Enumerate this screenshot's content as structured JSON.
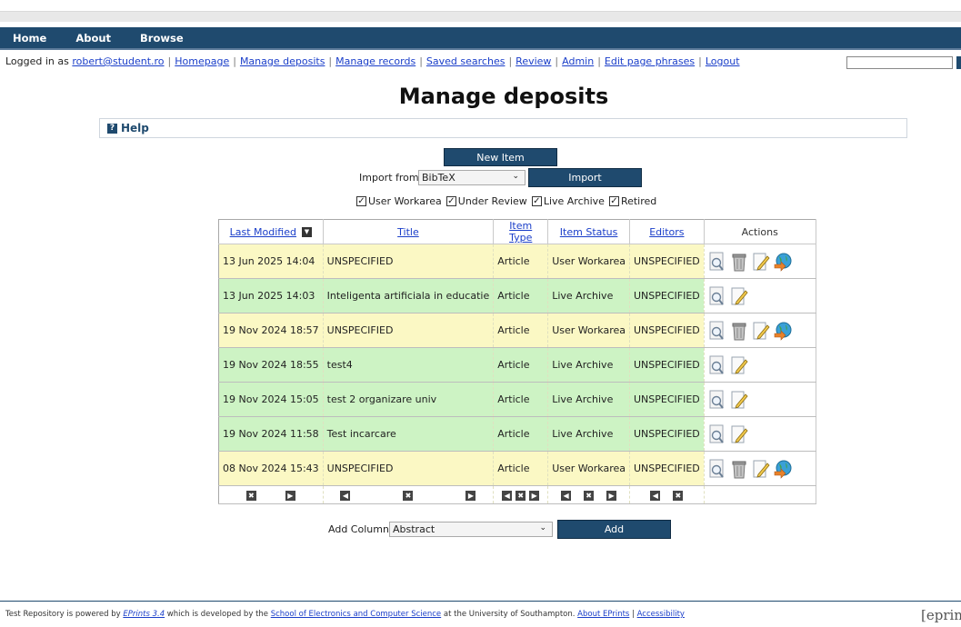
{
  "nav": {
    "home": "Home",
    "about": "About",
    "browse": "Browse"
  },
  "userbar": {
    "prefix": "Logged in as",
    "user": "robert@student.ro",
    "links": [
      "Homepage",
      "Manage deposits",
      "Manage records",
      "Saved searches",
      "Review",
      "Admin",
      "Edit page phrases",
      "Logout"
    ]
  },
  "page_title": "Manage deposits",
  "help": {
    "label": "Help",
    "icon": "?"
  },
  "controls": {
    "new_item": "New Item",
    "import_label": "Import from",
    "import_value": "BibTeX",
    "import_button": "Import",
    "filters": [
      "User Workarea",
      "Under Review",
      "Live Archive",
      "Retired"
    ],
    "add_column_label": "Add Column",
    "add_column_value": "Abstract",
    "add_button": "Add"
  },
  "table": {
    "headers": [
      "Last Modified",
      "Title",
      "Item Type",
      "Item Status",
      "Editors",
      "Actions"
    ],
    "rows": [
      {
        "modified": "13 Jun 2025 14:04",
        "title": "UNSPECIFIED",
        "type": "Article",
        "status": "User Workarea",
        "editors": "UNSPECIFIED",
        "kind": "inbox"
      },
      {
        "modified": "13 Jun 2025 14:03",
        "title": "Inteligenta artificiala in educatie",
        "type": "Article",
        "status": "Live Archive",
        "editors": "UNSPECIFIED",
        "kind": "archive"
      },
      {
        "modified": "19 Nov 2024 18:57",
        "title": "UNSPECIFIED",
        "type": "Article",
        "status": "User Workarea",
        "editors": "UNSPECIFIED",
        "kind": "inbox"
      },
      {
        "modified": "19 Nov 2024 18:55",
        "title": "test4",
        "type": "Article",
        "status": "Live Archive",
        "editors": "UNSPECIFIED",
        "kind": "archive"
      },
      {
        "modified": "19 Nov 2024 15:05",
        "title": "test 2 organizare univ",
        "type": "Article",
        "status": "Live Archive",
        "editors": "UNSPECIFIED",
        "kind": "archive"
      },
      {
        "modified": "19 Nov 2024 11:58",
        "title": "Test incarcare",
        "type": "Article",
        "status": "Live Archive",
        "editors": "UNSPECIFIED",
        "kind": "archive"
      },
      {
        "modified": "08 Nov 2024 15:43",
        "title": "UNSPECIFIED",
        "type": "Article",
        "status": "User Workarea",
        "editors": "UNSPECIFIED",
        "kind": "inbox"
      }
    ]
  },
  "footer": {
    "t1": "Test Repository is powered by ",
    "l1": "EPrints 3.4",
    "t2": " which is developed by the ",
    "l2": "School of Electronics and Computer Science",
    "t3": " at the University of Southampton. ",
    "l3": "About EPrints",
    "sep": " | ",
    "l4": "Accessibility"
  },
  "logo_text": "[eprin",
  "colors": {
    "nav": "#1f4a6e",
    "inbox_row": "#fbf8c4",
    "archive_row": "#cdf3c4"
  }
}
